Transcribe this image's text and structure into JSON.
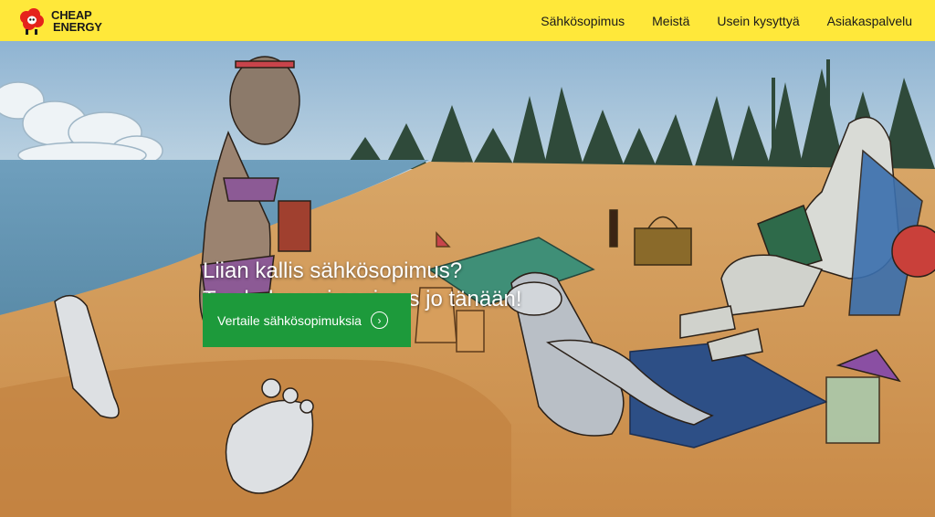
{
  "brand": {
    "logo_line1": "CHEAP",
    "logo_line2": "ENERGY",
    "logo_icon": "red-sheep-logo-icon",
    "colors": {
      "header_bg": "#ffe83a",
      "cta_bg": "#1d9a3b",
      "logo_red": "#e5231b"
    }
  },
  "nav": {
    "items": [
      {
        "label": "Sähkösopimus"
      },
      {
        "label": "Meistä"
      },
      {
        "label": "Usein kysyttyä"
      },
      {
        "label": "Asiakaspalvelu"
      }
    ]
  },
  "hero": {
    "headline_line1": "Liian kallis sähkösopimus?",
    "headline_line2": "Tee halvempi sopimus jo tänään!",
    "cta_label": "Vertaile sähkösopimuksia",
    "cta_icon": "chevron-right-circle-icon",
    "illustration": "cartoon-sheep-beach-scene"
  }
}
